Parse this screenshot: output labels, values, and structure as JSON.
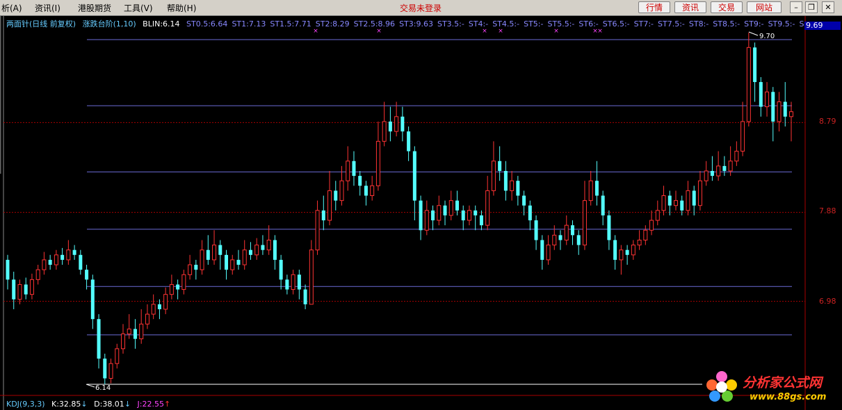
{
  "menubar": {
    "items": [
      "析(A)",
      "资讯(I)",
      "港股期货",
      "工具(V)",
      "帮助(H)"
    ],
    "login_status": "交易未登录",
    "right_buttons": [
      "行情",
      "资讯",
      "交易",
      "网站"
    ]
  },
  "legend": {
    "title": "两面针(日线 前复权)",
    "indicator": "涨跌台阶(1,10)",
    "blin": "BLIN:6.14",
    "steps": [
      "ST0.5:6.64",
      "ST1:7.13",
      "ST1.5:7.71",
      "ST2:8.29",
      "ST2.5:8.96",
      "ST3:9.63",
      "ST3.5:-",
      "ST4:-",
      "ST4.5:-",
      "ST5:-",
      "ST5.5:-",
      "ST6:-",
      "ST6.5:-",
      "ST7:-",
      "ST7.5:-",
      "ST8:-",
      "ST8.5:-",
      "ST9:-",
      "ST9.5:-",
      "S"
    ]
  },
  "price_box": "9.69",
  "annotations": {
    "high": "9.70",
    "low": "6.14"
  },
  "y_axis": [
    "8.79",
    "7.88",
    "6.98"
  ],
  "kdj": {
    "name": "KDJ(9,3,3)",
    "k": "K:32.85",
    "d": "D:38.01",
    "j": "J:22.55"
  },
  "logo": {
    "title": "分析家公式网",
    "url": "www.88gs.com"
  },
  "colors": {
    "up": "#ff3333",
    "down": "#54ffff",
    "step_line": "#6b6bd6",
    "grid": "#aa0000",
    "text_cyan": "#66ccff",
    "text_blue": "#8888ff",
    "magenta": "#ff44ff"
  },
  "chart_data": {
    "type": "candlestick",
    "ylim": [
      6.0,
      9.95
    ],
    "step_levels": [
      6.14,
      6.64,
      7.13,
      7.71,
      8.29,
      8.96,
      9.63
    ],
    "candles": [
      [
        7.4,
        7.2,
        7.45,
        7.1
      ],
      [
        7.2,
        7.0,
        7.28,
        6.9
      ],
      [
        7.0,
        7.15,
        7.2,
        6.95
      ],
      [
        7.15,
        7.05,
        7.22,
        7.0
      ],
      [
        7.05,
        7.2,
        7.26,
        7.0
      ],
      [
        7.2,
        7.3,
        7.35,
        7.15
      ],
      [
        7.3,
        7.4,
        7.48,
        7.25
      ],
      [
        7.4,
        7.35,
        7.45,
        7.3
      ],
      [
        7.35,
        7.45,
        7.5,
        7.3
      ],
      [
        7.45,
        7.4,
        7.52,
        7.35
      ],
      [
        7.4,
        7.5,
        7.6,
        7.35
      ],
      [
        7.5,
        7.45,
        7.55,
        7.4
      ],
      [
        7.45,
        7.3,
        7.5,
        7.25
      ],
      [
        7.3,
        7.2,
        7.35,
        7.1
      ],
      [
        7.2,
        6.8,
        7.25,
        6.7
      ],
      [
        6.8,
        6.4,
        6.85,
        6.3
      ],
      [
        6.4,
        6.2,
        6.45,
        6.14
      ],
      [
        6.2,
        6.35,
        6.4,
        6.15
      ],
      [
        6.35,
        6.5,
        6.55,
        6.3
      ],
      [
        6.5,
        6.65,
        6.75,
        6.45
      ],
      [
        6.65,
        6.7,
        6.85,
        6.6
      ],
      [
        6.7,
        6.6,
        6.8,
        6.5
      ],
      [
        6.6,
        6.75,
        6.9,
        6.55
      ],
      [
        6.75,
        6.85,
        6.95,
        6.7
      ],
      [
        6.85,
        6.95,
        7.05,
        6.8
      ],
      [
        6.95,
        6.9,
        7.0,
        6.8
      ],
      [
        6.9,
        7.05,
        7.12,
        6.85
      ],
      [
        7.05,
        7.15,
        7.25,
        7.0
      ],
      [
        7.15,
        7.1,
        7.2,
        7.0
      ],
      [
        7.1,
        7.25,
        7.3,
        7.05
      ],
      [
        7.25,
        7.35,
        7.45,
        7.2
      ],
      [
        7.35,
        7.3,
        7.4,
        7.2
      ],
      [
        7.3,
        7.5,
        7.6,
        7.25
      ],
      [
        7.5,
        7.4,
        7.65,
        7.35
      ],
      [
        7.4,
        7.55,
        7.7,
        7.35
      ],
      [
        7.55,
        7.45,
        7.6,
        7.3
      ],
      [
        7.45,
        7.3,
        7.5,
        7.2
      ],
      [
        7.3,
        7.4,
        7.45,
        7.25
      ],
      [
        7.4,
        7.35,
        7.5,
        7.3
      ],
      [
        7.35,
        7.5,
        7.6,
        7.3
      ],
      [
        7.5,
        7.45,
        7.58,
        7.4
      ],
      [
        7.45,
        7.55,
        7.62,
        7.4
      ],
      [
        7.55,
        7.5,
        7.65,
        7.45
      ],
      [
        7.5,
        7.6,
        7.75,
        7.45
      ],
      [
        7.6,
        7.4,
        7.65,
        7.3
      ],
      [
        7.4,
        7.2,
        7.45,
        7.1
      ],
      [
        7.2,
        7.1,
        7.25,
        7.05
      ],
      [
        7.1,
        7.25,
        7.3,
        7.05
      ],
      [
        7.25,
        7.1,
        7.3,
        7.0
      ],
      [
        7.1,
        6.95,
        7.15,
        6.9
      ],
      [
        6.95,
        7.5,
        7.6,
        6.95
      ],
      [
        7.5,
        7.9,
        8.0,
        7.45
      ],
      [
        7.9,
        7.8,
        8.05,
        7.7
      ],
      [
        7.8,
        8.1,
        8.3,
        7.75
      ],
      [
        8.1,
        8.0,
        8.2,
        7.9
      ],
      [
        8.0,
        8.2,
        8.35,
        7.95
      ],
      [
        8.2,
        8.4,
        8.55,
        8.1
      ],
      [
        8.4,
        8.25,
        8.5,
        8.15
      ],
      [
        8.25,
        8.15,
        8.3,
        8.05
      ],
      [
        8.15,
        8.05,
        8.2,
        7.95
      ],
      [
        8.05,
        8.15,
        8.25,
        8.0
      ],
      [
        8.15,
        8.6,
        8.8,
        8.1
      ],
      [
        8.6,
        8.8,
        9.0,
        8.55
      ],
      [
        8.8,
        8.7,
        8.95,
        8.6
      ],
      [
        8.7,
        8.85,
        9.0,
        8.65
      ],
      [
        8.85,
        8.7,
        8.95,
        8.6
      ],
      [
        8.7,
        8.5,
        8.75,
        8.4
      ],
      [
        8.5,
        8.0,
        8.55,
        7.8
      ],
      [
        8.0,
        7.7,
        8.05,
        7.6
      ],
      [
        7.7,
        7.9,
        8.0,
        7.65
      ],
      [
        7.9,
        7.8,
        7.95,
        7.7
      ],
      [
        7.8,
        7.95,
        8.05,
        7.75
      ],
      [
        7.95,
        7.85,
        8.0,
        7.75
      ],
      [
        7.85,
        8.0,
        8.1,
        7.8
      ],
      [
        8.0,
        7.9,
        8.1,
        7.85
      ],
      [
        7.9,
        7.8,
        7.95,
        7.7
      ],
      [
        7.8,
        7.9,
        7.95,
        7.75
      ],
      [
        7.9,
        7.85,
        7.95,
        7.7
      ],
      [
        7.85,
        7.75,
        7.9,
        7.7
      ],
      [
        7.75,
        8.1,
        8.25,
        7.7
      ],
      [
        8.1,
        8.4,
        8.6,
        8.05
      ],
      [
        8.4,
        8.3,
        8.55,
        8.2
      ],
      [
        8.3,
        8.1,
        8.4,
        8.0
      ],
      [
        8.1,
        8.2,
        8.3,
        8.0
      ],
      [
        8.2,
        8.05,
        8.25,
        7.95
      ],
      [
        8.05,
        7.95,
        8.1,
        7.85
      ],
      [
        7.95,
        7.8,
        8.0,
        7.7
      ],
      [
        7.8,
        7.6,
        7.85,
        7.5
      ],
      [
        7.6,
        7.4,
        7.65,
        7.3
      ],
      [
        7.4,
        7.55,
        7.65,
        7.35
      ],
      [
        7.55,
        7.65,
        7.75,
        7.5
      ],
      [
        7.65,
        7.6,
        7.7,
        7.5
      ],
      [
        7.6,
        7.75,
        7.85,
        7.55
      ],
      [
        7.75,
        7.65,
        7.8,
        7.55
      ],
      [
        7.65,
        7.55,
        7.7,
        7.45
      ],
      [
        7.55,
        8.0,
        8.2,
        7.5
      ],
      [
        8.0,
        8.2,
        8.3,
        7.95
      ],
      [
        8.2,
        8.05,
        8.4,
        7.95
      ],
      [
        8.05,
        7.85,
        8.1,
        7.75
      ],
      [
        7.85,
        7.6,
        7.9,
        7.5
      ],
      [
        7.6,
        7.4,
        7.65,
        7.3
      ],
      [
        7.4,
        7.5,
        7.55,
        7.25
      ],
      [
        7.5,
        7.45,
        7.55,
        7.35
      ],
      [
        7.45,
        7.55,
        7.6,
        7.4
      ],
      [
        7.55,
        7.6,
        7.7,
        7.5
      ],
      [
        7.6,
        7.7,
        7.75,
        7.55
      ],
      [
        7.7,
        7.8,
        7.9,
        7.65
      ],
      [
        7.8,
        7.9,
        8.0,
        7.75
      ],
      [
        7.9,
        8.05,
        8.15,
        7.85
      ],
      [
        8.05,
        7.95,
        8.1,
        7.85
      ],
      [
        7.95,
        8.0,
        8.1,
        7.9
      ],
      [
        8.0,
        7.9,
        8.05,
        7.85
      ],
      [
        7.9,
        8.1,
        8.2,
        7.85
      ],
      [
        8.1,
        7.95,
        8.15,
        7.85
      ],
      [
        7.95,
        8.2,
        8.3,
        7.9
      ],
      [
        8.2,
        8.3,
        8.4,
        8.15
      ],
      [
        8.3,
        8.25,
        8.45,
        8.2
      ],
      [
        8.25,
        8.35,
        8.5,
        8.2
      ],
      [
        8.35,
        8.3,
        8.45,
        8.25
      ],
      [
        8.3,
        8.4,
        8.55,
        8.25
      ],
      [
        8.4,
        8.5,
        8.6,
        8.35
      ],
      [
        8.5,
        8.8,
        9.0,
        8.45
      ],
      [
        8.8,
        9.55,
        9.7,
        8.75
      ],
      [
        9.55,
        9.2,
        9.6,
        9.0
      ],
      [
        9.2,
        8.95,
        9.25,
        8.85
      ],
      [
        8.95,
        9.1,
        9.2,
        8.85
      ],
      [
        9.1,
        8.8,
        9.15,
        8.6
      ],
      [
        8.8,
        9.0,
        9.1,
        8.7
      ],
      [
        9.0,
        8.85,
        9.2,
        8.75
      ],
      [
        8.85,
        8.9,
        9.0,
        8.6
      ]
    ]
  }
}
